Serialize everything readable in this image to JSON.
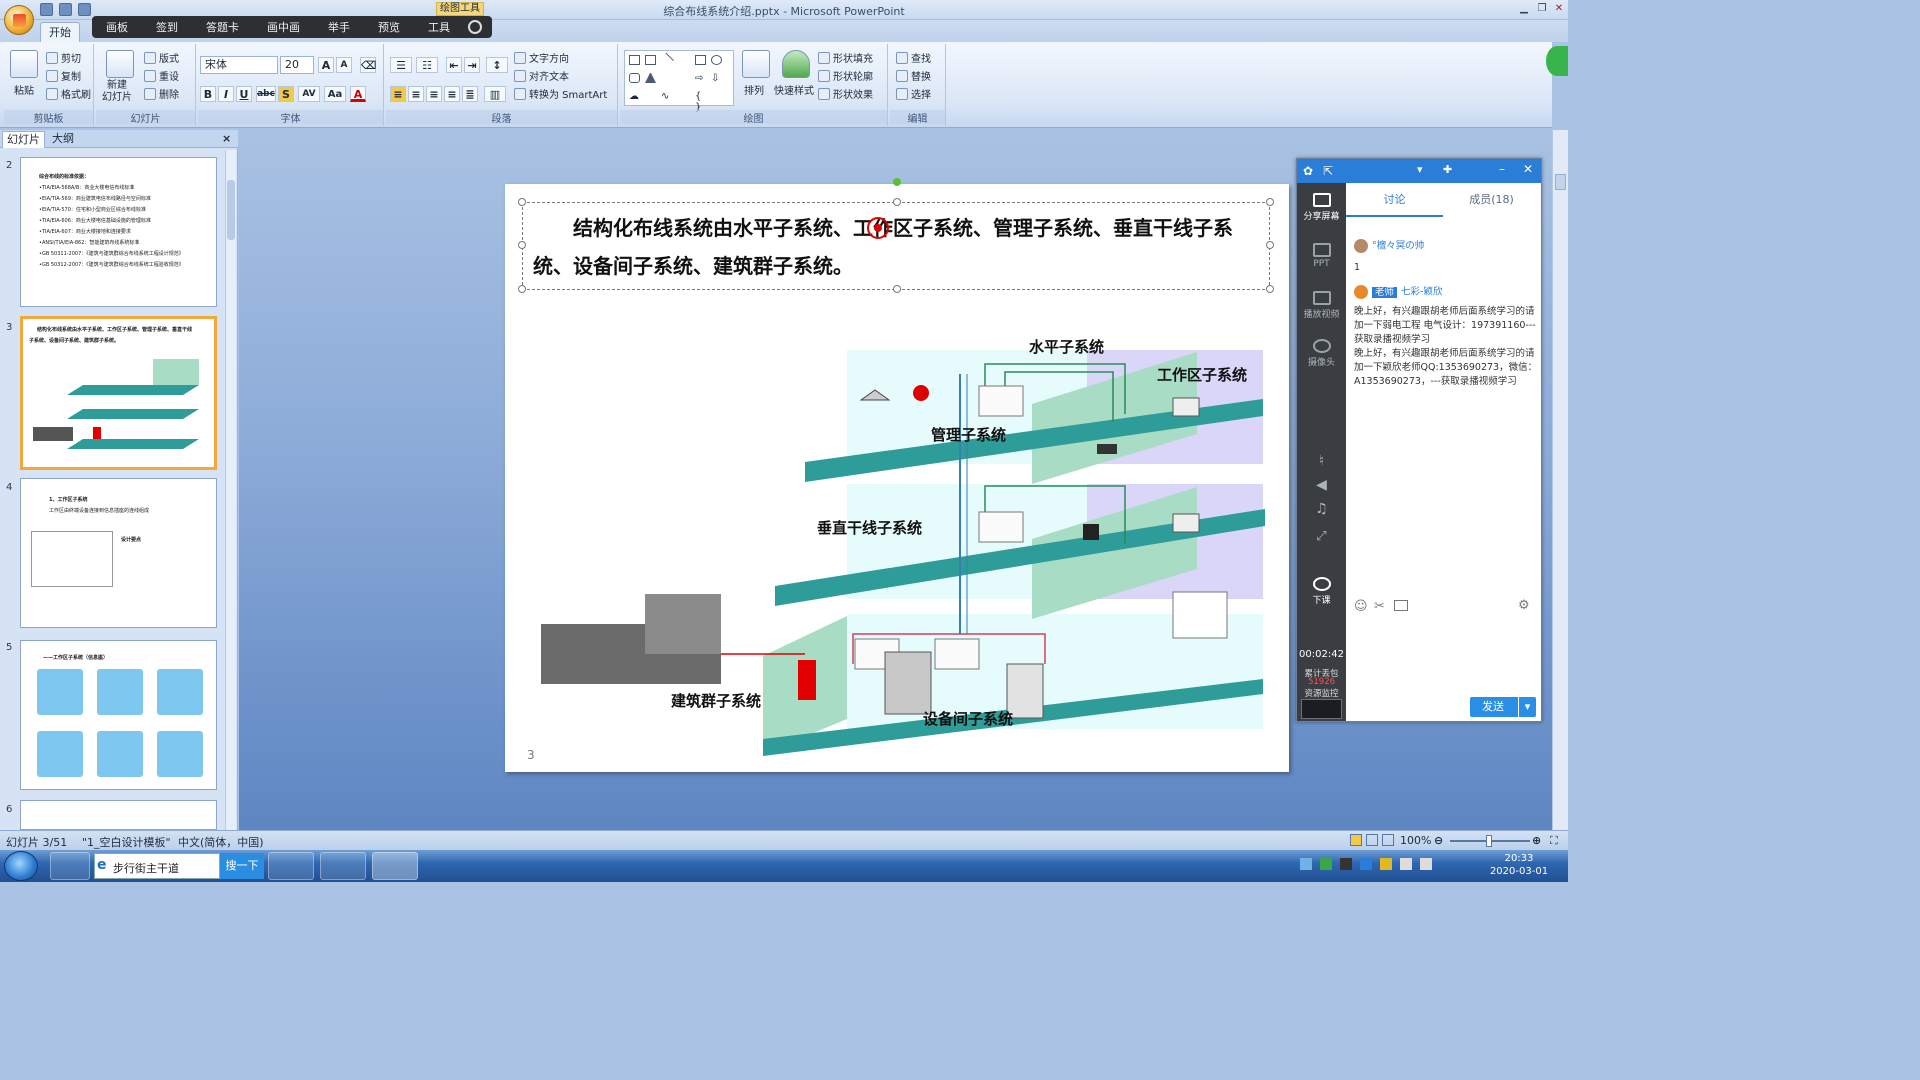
{
  "window": {
    "title": "综合布线系统介绍.pptx - Microsoft PowerPoint",
    "context_tab": "绘图工具"
  },
  "overlay_toolbar": {
    "items": [
      "画板",
      "签到",
      "答题卡",
      "画中画",
      "举手",
      "预览",
      "工具"
    ]
  },
  "ribbon": {
    "active_tab": "开始",
    "groups": {
      "clipboard": {
        "label": "剪贴板",
        "paste": "粘贴",
        "cut": "剪切",
        "copy": "复制",
        "format_painter": "格式刷"
      },
      "slides": {
        "label": "幻灯片",
        "new_slide": "新建\n幻灯片",
        "layout": "版式",
        "reset": "重设",
        "delete": "删除"
      },
      "font": {
        "label": "字体",
        "font_name": "宋体",
        "font_size": "20",
        "bold": "B",
        "italic": "I",
        "underline": "U",
        "strike": "abc",
        "shadow": "S",
        "spacing": "AV",
        "case": "Aa",
        "color": "A"
      },
      "paragraph": {
        "label": "段落",
        "text_direction": "文字方向",
        "align_text": "对齐文本",
        "smartart": "转换为 SmartArt"
      },
      "drawing": {
        "label": "绘图",
        "arrange": "排列",
        "quick_styles": "快速样式",
        "shape_fill": "形状填充",
        "shape_outline": "形状轮廓",
        "shape_effects": "形状效果"
      },
      "editing": {
        "label": "编辑",
        "find": "查找",
        "replace": "替换",
        "select": "选择"
      }
    }
  },
  "left_panel": {
    "tabs": [
      "幻灯片",
      "大纲"
    ],
    "thumbs": [
      {
        "num": "2",
        "lines": [
          "综合布线的标准依据：",
          "•TIA/EIA-568A/B：商业大楼电信布线标准",
          "•EIA/TIA-569：商业建筑电信布线路径与空间标准",
          "•EIA/TIA-570：住宅和小型商业区综合布线标准",
          "•TIA/EIA-606：商业大楼电信基础设施的管理标准",
          "•TIA/EIA-607：商业大楼接地和连接要求",
          "•ANSI/TIA/EIA-862：智能建筑布线系统标准",
          "•GB 50311-2007：《建筑与建筑群综合布线系统工程设计规范》",
          "•GB 50312-2007：《建筑与建筑群综合布线系统工程验收规范》"
        ]
      },
      {
        "num": "3",
        "lines": [
          "结构化布线系统由水平子系统、工作区子系统、管理子系统、垂直干线",
          "子系统、设备间子系统、建筑群子系统。"
        ]
      },
      {
        "num": "4",
        "lines": [
          "1、工作区子系统",
          "工作区由终端设备连接到信息插座的连线组成",
          "设计要点"
        ]
      },
      {
        "num": "5",
        "lines": [
          "——工作区子系统（信息座）"
        ]
      },
      {
        "num": "6",
        "lines": []
      }
    ]
  },
  "slide": {
    "title": "结构化布线系统由水平子系统、工作区子系统、管理子系统、垂直干线子系统、设备间子系统、建筑群子系统。",
    "labels": {
      "horizontal": "水平子系统",
      "work_area": "工作区子系统",
      "management": "管理子系统",
      "backbone": "垂直干线子系统",
      "campus": "建筑群子系统",
      "equipment_room": "设备间子系统"
    },
    "number": "3"
  },
  "chat": {
    "tabs": [
      "讨论",
      "成员(18)"
    ],
    "side_items": [
      "分享屏幕",
      "PPT",
      "播放视频",
      "摄像头",
      "下课"
    ],
    "timer": "00:02:42",
    "stats_label": "累计丢包",
    "stats_value": "51926",
    "monitor_label": "资源监控",
    "messages": [
      {
        "name": "°檀々冥の帅",
        "text": "1"
      },
      {
        "badge": "老师",
        "name": "七彩-颖欣",
        "text": "晚上好，有兴趣跟胡老师后面系统学习的请加一下弱电工程 电气设计：197391160---获取录播视频学习\n晚上好，有兴趣跟胡老师后面系统学习的请加一下颖欣老师QQ:1353690273，微信：A1353690273，---获取录播视频学习"
      }
    ],
    "send_label": "发送"
  },
  "status_bar": {
    "slide_pos": "幻灯片 3/51",
    "theme": "\"1_空白设计模板\"",
    "language": "中文(简体，中国)",
    "zoom": "100%"
  },
  "taskbar": {
    "search_text": "步行街主干道",
    "search_btn": "搜一下",
    "time": "20:33",
    "date": "2020-03-01"
  },
  "colors": {
    "accent": "#2a7ed8",
    "floor": "#2e9c98",
    "wall": "#a8dcc5"
  }
}
